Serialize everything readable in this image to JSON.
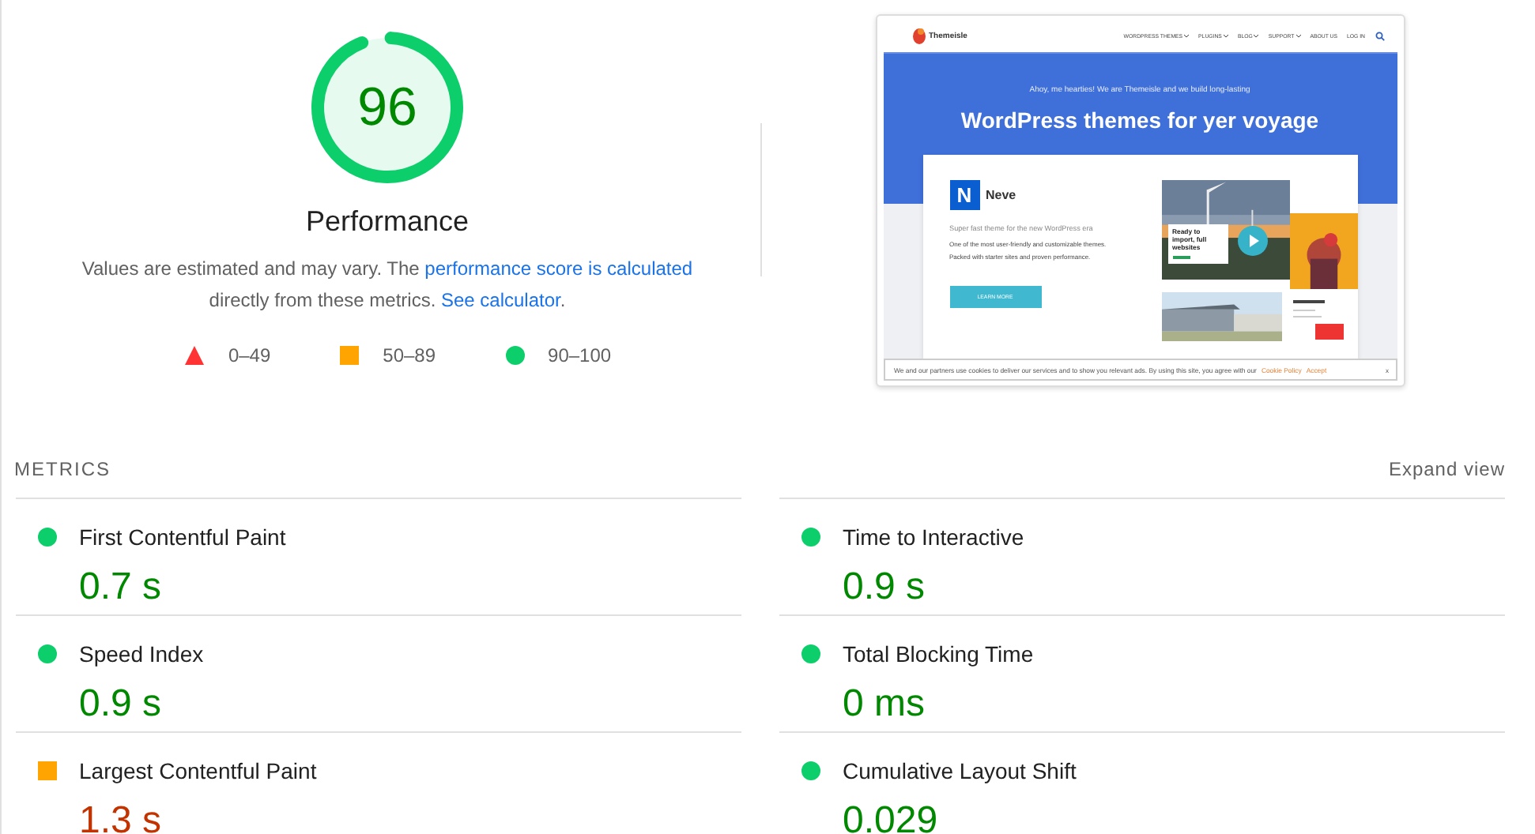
{
  "score": {
    "value": "96",
    "label": "Performance",
    "level": 0.96
  },
  "description": [
    {
      "kind": "text",
      "text": "Values are estimated and may vary. The "
    },
    {
      "kind": "link",
      "text": "performance score is calculated"
    },
    {
      "kind": "text",
      "text": " directly from these metrics. "
    },
    {
      "kind": "link",
      "text": "See calculator"
    },
    {
      "kind": "text",
      "text": "."
    }
  ],
  "legend": [
    {
      "kind": "fail",
      "range": "0–49"
    },
    {
      "kind": "average",
      "range": "50–89"
    },
    {
      "kind": "pass",
      "range": "90–100"
    }
  ],
  "screenshot": {
    "brand": "Themeisle",
    "nav": [
      {
        "label": "WORDPRESS THEMES",
        "has_menu": true
      },
      {
        "label": "PLUGINS",
        "has_menu": true
      },
      {
        "label": "BLOG",
        "has_menu": true
      },
      {
        "label": "SUPPORT",
        "has_menu": true
      },
      {
        "label": "ABOUT US",
        "has_menu": false
      },
      {
        "label": "LOG IN",
        "has_menu": false
      }
    ],
    "intro": "Ahoy, me hearties! We are Themeisle and we build long-lasting",
    "headline": "WordPress themes for yer voyage",
    "product": {
      "logo_letter": "N",
      "name": "Neve",
      "tagline": "Super fast theme for the new WordPress era",
      "body": "One of the most user-friendly and customizable themes. Packed with starter sites and proven performance.",
      "button": "LEARN MORE",
      "promo": "Ready to import, full websites"
    },
    "cookie": {
      "text": "We and our partners use cookies to deliver our services and to show you relevant ads. By using this site, you agree with our",
      "policy": "Cookie Policy",
      "accept": "Accept",
      "close": "x"
    }
  },
  "metrics": {
    "title": "METRICS",
    "toggle": "Expand view",
    "items": [
      {
        "title": "First Contentful Paint",
        "value": "0.7 s",
        "kind": "pass"
      },
      {
        "title": "Time to Interactive",
        "value": "0.9 s",
        "kind": "pass"
      },
      {
        "title": "Speed Index",
        "value": "0.9 s",
        "kind": "pass"
      },
      {
        "title": "Total Blocking Time",
        "value": "0 ms",
        "kind": "pass"
      },
      {
        "title": "Largest Contentful Paint",
        "value": "1.3 s",
        "kind": "average"
      },
      {
        "title": "Cumulative Layout Shift",
        "value": "0.029",
        "kind": "pass"
      }
    ]
  }
}
